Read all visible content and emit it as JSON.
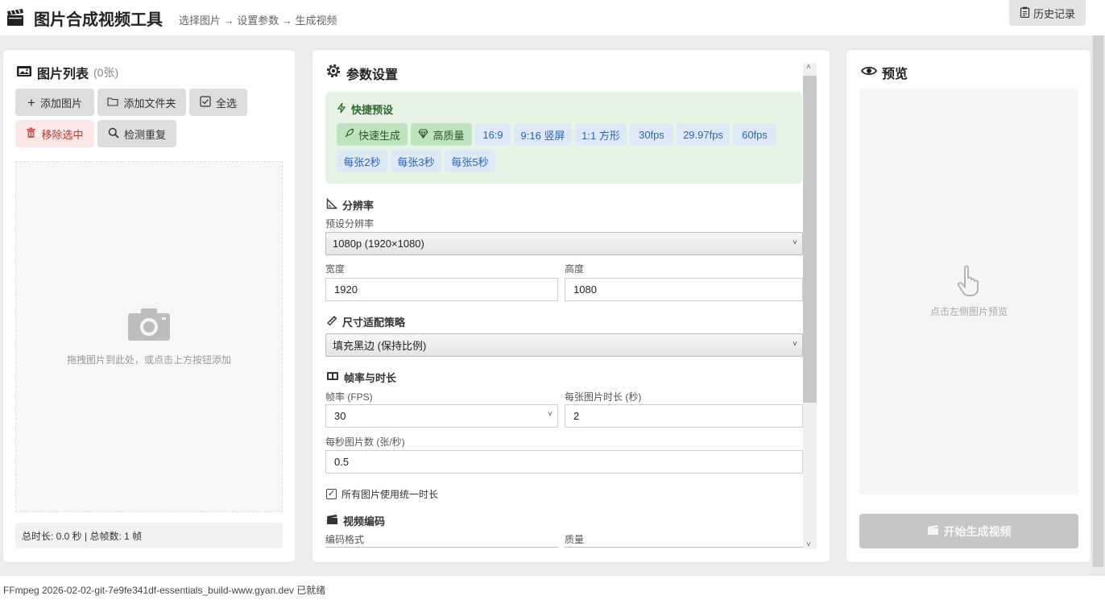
{
  "header": {
    "title": "图片合成视频工具",
    "subtitle": "选择图片 → 设置参数 → 生成视频",
    "history_label": "历史记录"
  },
  "images_panel": {
    "title": "图片列表",
    "count": "(0张)",
    "add_images": "添加图片",
    "add_folder": "添加文件夹",
    "select_all": "全选",
    "remove_selected": "移除选中",
    "detect_duplicates": "检测重复",
    "drop_hint": "拖拽图片到此处，或点击上方按钮添加",
    "status": "总时长: 0.0 秒 | 总帧数: 1 帧"
  },
  "settings_panel": {
    "title": "参数设置",
    "presets": {
      "title": "快捷预设",
      "green": [
        {
          "label": "快速生成",
          "icon": "rocket-icon"
        },
        {
          "label": "高质量",
          "icon": "diamond-icon"
        }
      ],
      "blue_row1": [
        "16:9",
        "9:16 竖屏",
        "1:1 方形",
        "30fps",
        "29.97fps",
        "60fps"
      ],
      "blue_row2": [
        "每张2秒",
        "每张3秒",
        "每张5秒"
      ]
    },
    "resolution": {
      "title": "分辨率",
      "preset_label": "预设分辨率",
      "preset_value": "1080p (1920×1080)",
      "width_label": "宽度",
      "width_value": "1920",
      "height_label": "高度",
      "height_value": "1080"
    },
    "fit": {
      "title": "尺寸适配策略",
      "value": "填充黑边 (保持比例)"
    },
    "framerate": {
      "title": "帧率与时长",
      "fps_label": "帧率 (FPS)",
      "fps_value": "30",
      "duration_label": "每张图片时长 (秒)",
      "duration_value": "2",
      "ips_label": "每秒图片数 (张/秒)",
      "ips_value": "0.5",
      "uniform_label": "所有图片使用统一时长",
      "uniform_checked": true
    },
    "encoding": {
      "title": "视频编码",
      "codec_label": "编码格式",
      "quality_label": "质量"
    }
  },
  "preview_panel": {
    "title": "预览",
    "hint": "点击左侧图片预览",
    "generate_label": "开始生成视频"
  },
  "footer": {
    "status": "FFmpeg 2026-02-02-git-7e9fe341df-essentials_build-www.gyan.dev 已就绪"
  },
  "colors": {
    "preset_bg": "#e6f4e6",
    "green_chip": "#bfe3bf",
    "blue_chip_text": "#2a66b0",
    "danger": "#c0392b",
    "disabled_button": "#c6c6c6"
  }
}
